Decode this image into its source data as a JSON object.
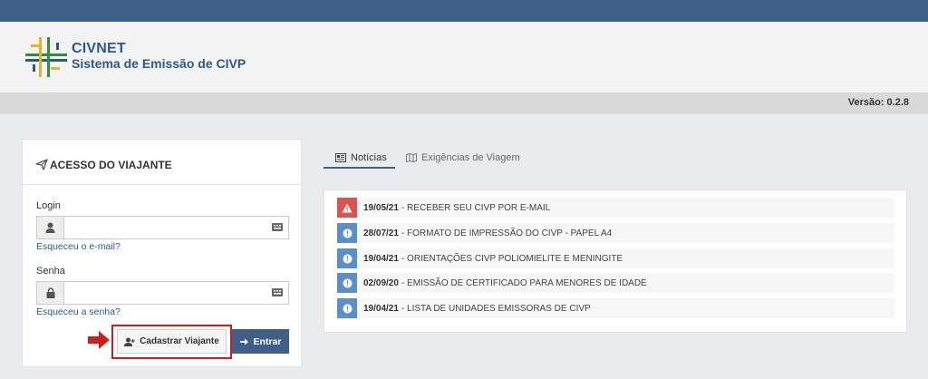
{
  "app": {
    "name": "CIVNET",
    "subtitle": "Sistema de Emissão de CIVP",
    "version_text": "Versão: 0.2.8"
  },
  "login_panel": {
    "title": "ACESSO DO VIAJANTE",
    "login_label": "Login",
    "login_value": "",
    "forgot_email": "Esqueceu o e-mail?",
    "password_label": "Senha",
    "password_value": "",
    "forgot_password": "Esqueceu a senha?",
    "register_button": "Cadastrar Viajante",
    "login_button": "Entrar"
  },
  "tabs": [
    {
      "label": "Notícias",
      "icon": "newspaper-icon",
      "active": true
    },
    {
      "label": "Exigências de Viagem",
      "icon": "map-icon",
      "active": false
    }
  ],
  "news": [
    {
      "date": "19/05/21",
      "text": "- RECEBER SEU CIVP POR E-MAIL",
      "type": "warning"
    },
    {
      "date": "28/07/21",
      "text": "- FORMATO DE IMPRESSÃO DO CIVP - PAPEL A4",
      "type": "info"
    },
    {
      "date": "19/04/21",
      "text": "- ORIENTAÇÕES CIVP POLIOMIELITE E MENINGITE",
      "type": "info"
    },
    {
      "date": "02/09/20",
      "text": "- EMISSÃO DE CERTIFICADO PARA MENORES DE IDADE",
      "type": "info"
    },
    {
      "date": "19/04/21",
      "text": "- LISTA DE UNIDADES EMISSORAS DE CIVP",
      "type": "info"
    }
  ],
  "colors": {
    "topbar": "#3e6088",
    "brand_text": "#2b5a8a",
    "warning_badge": "#d9534f",
    "info_badge": "#5b8fc7",
    "highlight": "#d11c1c"
  }
}
